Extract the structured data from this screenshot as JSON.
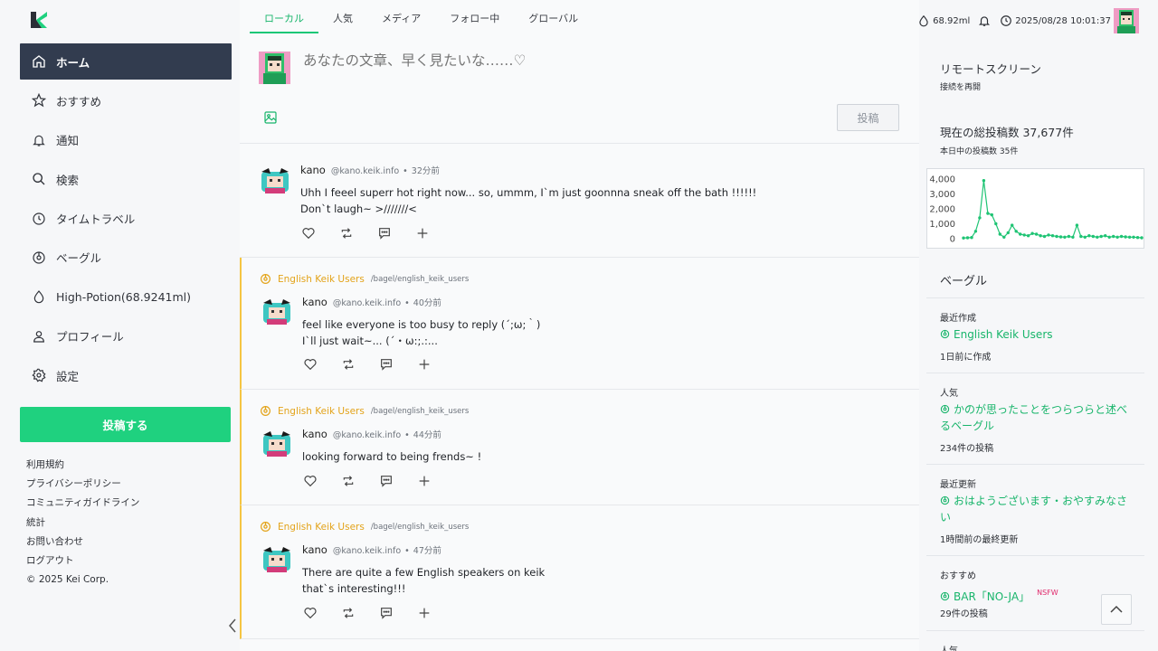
{
  "sidebar": {
    "logo_icon": "keik-logo-icon",
    "items": [
      {
        "label": "ホーム",
        "icon": "home-icon",
        "active": true
      },
      {
        "label": "おすすめ",
        "icon": "star-icon"
      },
      {
        "label": "通知",
        "icon": "bell-icon"
      },
      {
        "label": "検索",
        "icon": "search-icon"
      },
      {
        "label": "タイムトラベル",
        "icon": "clock-icon"
      },
      {
        "label": "ベーグル",
        "icon": "bagel-icon"
      },
      {
        "label": "High-Potion(68.9241ml)",
        "icon": "drop-icon"
      },
      {
        "label": "プロフィール",
        "icon": "user-icon"
      },
      {
        "label": "設定",
        "icon": "gear-icon"
      }
    ],
    "post_button": "投稿する",
    "footer": [
      "利用規約",
      "プライバシーポリシー",
      "コミュニティガイドライン",
      "統計",
      "お問い合わせ",
      "ログアウト",
      "© 2025 Kei Corp."
    ]
  },
  "tabs": [
    {
      "label": "ローカル",
      "active": true
    },
    {
      "label": "人気"
    },
    {
      "label": "メディア"
    },
    {
      "label": "フォロー中"
    },
    {
      "label": "グローバル"
    }
  ],
  "composer": {
    "placeholder": "あなたの文章、早く見たいな……♡",
    "submit": "投稿"
  },
  "posts": [
    {
      "bagel": null,
      "user": "kano",
      "handle": "@kano.keik.info",
      "time": "32分前",
      "body": "Uhh I feeel superr hot right now... so, ummm, I`m just goonnna sneak off the bath !!!!!!\nDon`t laugh~ >///////<"
    },
    {
      "bagel": "English Keik Users",
      "bagel_path": "/bagel/english_keik_users",
      "user": "kano",
      "handle": "@kano.keik.info",
      "time": "40分前",
      "body": "feel like everyone is too busy to reply (´;ω;｀)\nI`ll just wait~... (´・ω:;.:..."
    },
    {
      "bagel": "English Keik Users",
      "bagel_path": "/bagel/english_keik_users",
      "user": "kano",
      "handle": "@kano.keik.info",
      "time": "44分前",
      "body": "looking forward to being frends~ !"
    },
    {
      "bagel": "English Keik Users",
      "bagel_path": "/bagel/english_keik_users",
      "user": "kano",
      "handle": "@kano.keik.info",
      "time": "47分前",
      "body": "There are quite a few English speakers on keik\nthat`s interesting!!!"
    }
  ],
  "status": {
    "potion": "68.92ml",
    "datetime": "2025/08/28 10:01:37"
  },
  "right": {
    "remote_title": "リモートスクリーン",
    "remote_sub": "接続を再開",
    "total_title": "現在の総投稿数 37,677件",
    "today_sub": "本日中の投稿数 35件",
    "bagel_title": "ベーグル",
    "sections": [
      {
        "label": "最近作成",
        "name": "English Keik Users",
        "stat": "1日前に作成",
        "nsfw": ""
      },
      {
        "label": "人気",
        "name": "かのが思ったことをつらつらと述べるベーグル",
        "stat": "234件の投稿",
        "nsfw": ""
      },
      {
        "label": "最近更新",
        "name": "おはようございます・おやすみなさい",
        "stat": "1時間前の最終更新",
        "nsfw": ""
      },
      {
        "label": "おすすめ",
        "name": "BAR「NO-JA」",
        "stat": "29件の投稿",
        "nsfw": "NSFW"
      },
      {
        "label": "人気",
        "name": "",
        "stat": "",
        "nsfw": ""
      }
    ]
  },
  "chart_data": {
    "type": "line",
    "ylim": [
      0,
      4000
    ],
    "yticks": [
      "4,000",
      "3,000",
      "2,000",
      "1,000",
      "0"
    ],
    "values": [
      50,
      60,
      80,
      500,
      1400,
      3900,
      1700,
      1600,
      1000,
      300,
      100,
      400,
      900,
      500,
      300,
      250,
      200,
      350,
      300,
      200,
      150,
      250,
      200,
      150,
      120,
      100,
      150,
      100,
      900,
      150,
      100,
      200,
      150,
      100,
      150,
      200,
      100,
      150,
      100,
      150,
      120,
      100,
      100,
      80,
      60
    ],
    "color": "#1fc474"
  },
  "colors": {
    "accent": "#1fd17f",
    "bagel": "#e3a319",
    "nav_active": "#323c4f"
  }
}
